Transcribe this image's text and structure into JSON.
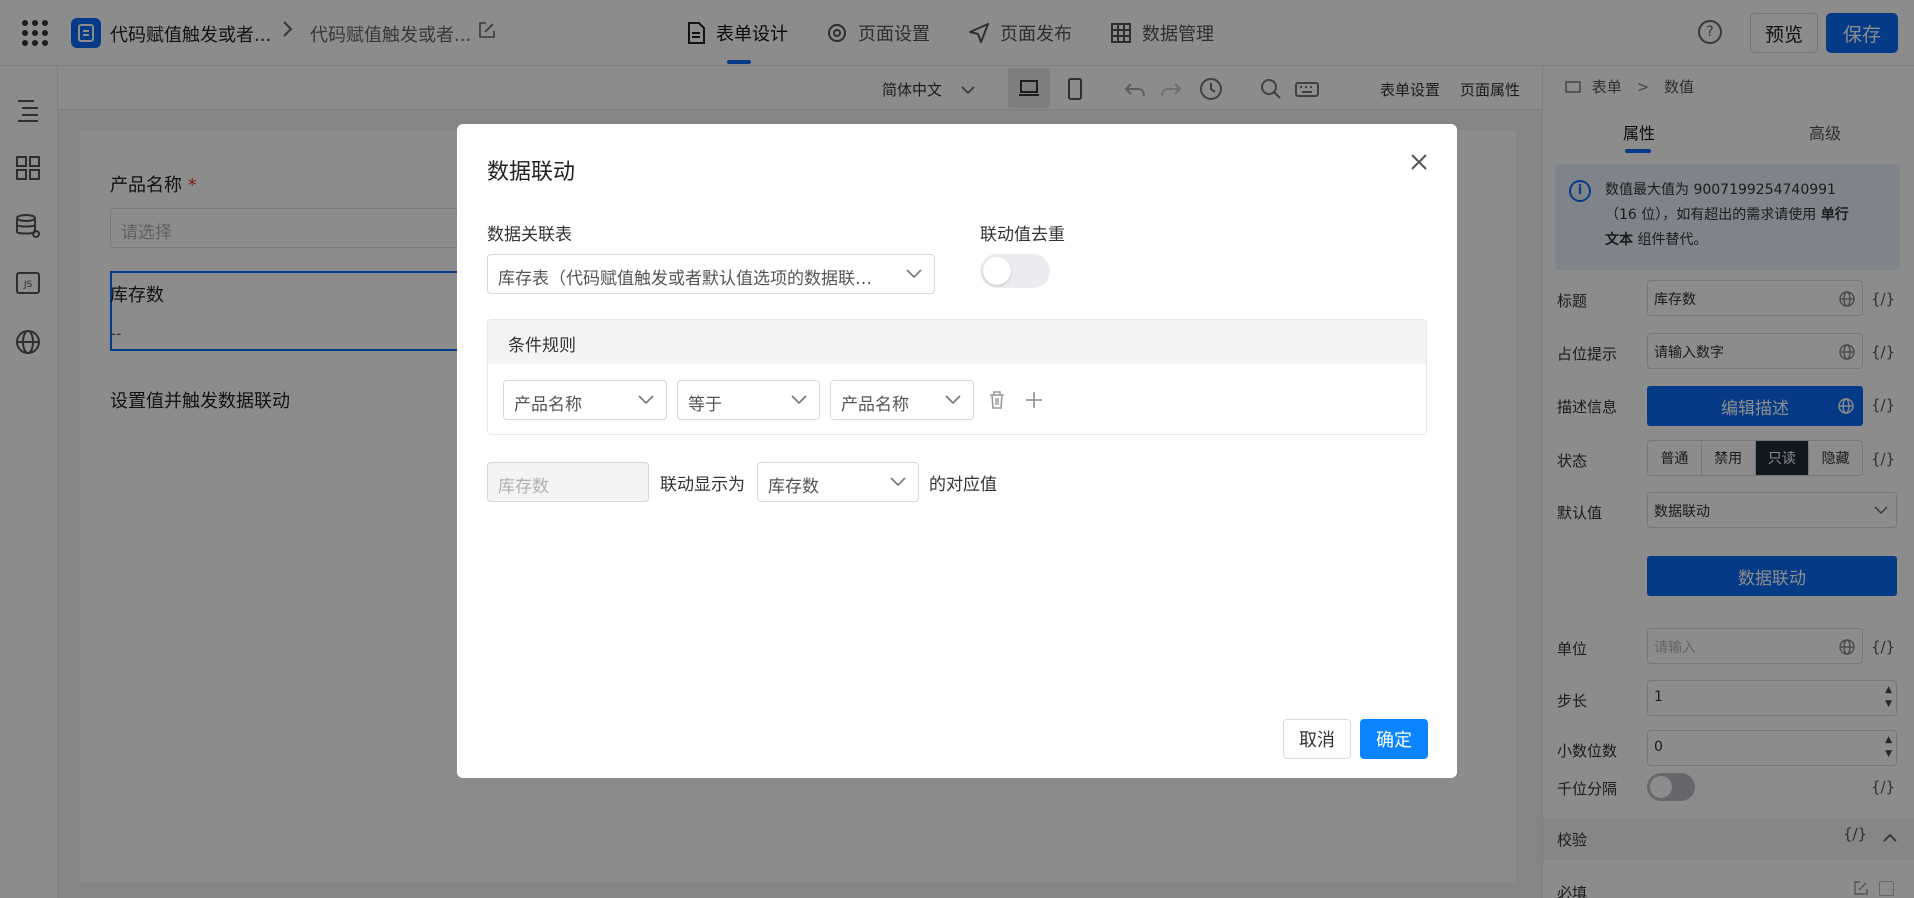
{
  "topbar": {
    "app_name": "代码赋值触发或者...",
    "page_name": "代码赋值触发或者...",
    "tabs": [
      {
        "label": "表单设计",
        "icon": "document-icon"
      },
      {
        "label": "页面设置",
        "icon": "gear-icon"
      },
      {
        "label": "页面发布",
        "icon": "send-icon"
      },
      {
        "label": "数据管理",
        "icon": "table-icon"
      }
    ],
    "help": "?",
    "preview_label": "预览",
    "save_label": "保存",
    "accent_color": "#0a6cf5"
  },
  "canvas_toolbar": {
    "language": "简体中文",
    "form_settings": "表单设置",
    "page_props": "页面属性"
  },
  "form": {
    "field1_label": "产品名称",
    "field1_required": "*",
    "field1_placeholder": "请选择",
    "field2_label": "库存数",
    "field2_value": "--",
    "field3_label": "设置值并触发数据联动"
  },
  "right_panel": {
    "breadcrumb_root": "表单",
    "breadcrumb_sep": ">",
    "breadcrumb_leaf": "数值",
    "tab_props": "属性",
    "tab_advanced": "高级",
    "info_line1": "数值最大值为 9007199254740991",
    "info_line2": "（16 位），如有超出的需求请使用",
    "info_bold": "单行",
    "info_line3_bold": "文本",
    "info_line3": " 组件替代。",
    "labels": {
      "title": "标题",
      "placeholder": "占位提示",
      "desc": "描述信息",
      "state": "状态",
      "default": "默认值",
      "unit": "单位",
      "step": "步长",
      "decimals": "小数位数",
      "thousands": "千位分隔",
      "verify": "校验",
      "required": "必填"
    },
    "title_value": "库存数",
    "placeholder_value": "请输入数字",
    "desc_button": "编辑描述",
    "states": [
      "普通",
      "禁用",
      "只读",
      "隐藏"
    ],
    "state_selected": "只读",
    "default_value": "数据联动",
    "linkage_button": "数据联动",
    "unit_placeholder": "请输入",
    "step_value": "1",
    "decimals_value": "0",
    "expr": "{/}"
  },
  "modal": {
    "title": "数据联动",
    "table_label": "数据关联表",
    "table_value": "库存表（代码赋值触发或者默认值选项的数据联…",
    "dedupe_label": "联动值去重",
    "condition_header": "条件规则",
    "cond_field": "产品名称",
    "cond_op": "等于",
    "cond_target": "产品名称",
    "result_field": "库存数",
    "result_text": "联动显示为",
    "result_select": "库存数",
    "result_suffix": "的对应值",
    "cancel": "取消",
    "ok": "确定"
  }
}
